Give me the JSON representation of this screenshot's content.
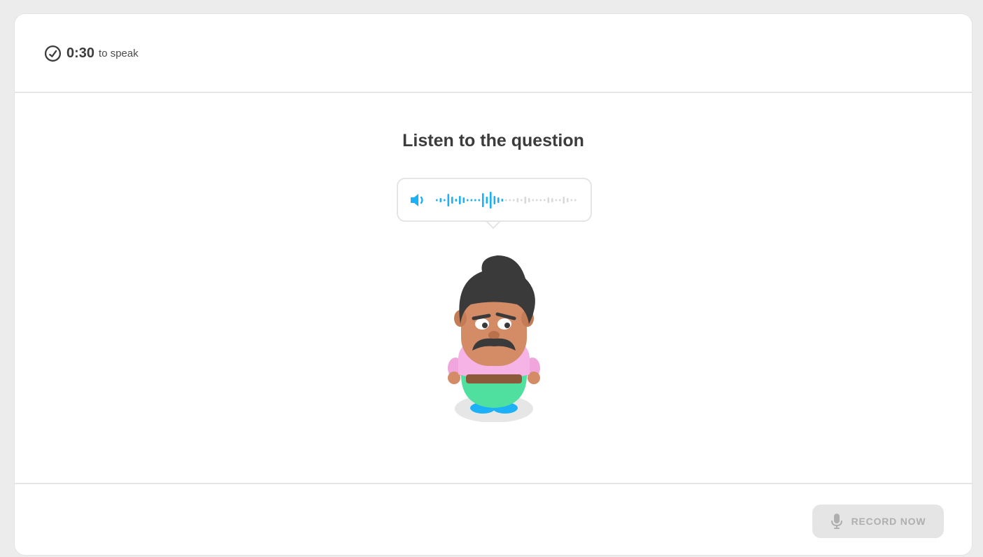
{
  "header": {
    "timer_value": "0:30",
    "timer_suffix": "to speak",
    "timer_icon": "stopwatch-icon"
  },
  "main": {
    "title": "Listen to the question",
    "audio_player": {
      "speaker_icon": "speaker-icon",
      "played_color": "#1cb0f6",
      "unplayed_color": "#d9d9d9"
    },
    "character": "mustached-man-illustration"
  },
  "footer": {
    "record_button_label": "RECORD NOW",
    "record_button_icon": "microphone-icon",
    "record_button_state": "disabled"
  },
  "colors": {
    "page_background": "#ececec",
    "card_background": "#ffffff",
    "divider": "#e5e5e5",
    "text_primary": "#3c3c3c",
    "accent_blue": "#1cb0f6",
    "button_disabled_bg": "#e5e5e5",
    "button_disabled_text": "#afafaf"
  }
}
